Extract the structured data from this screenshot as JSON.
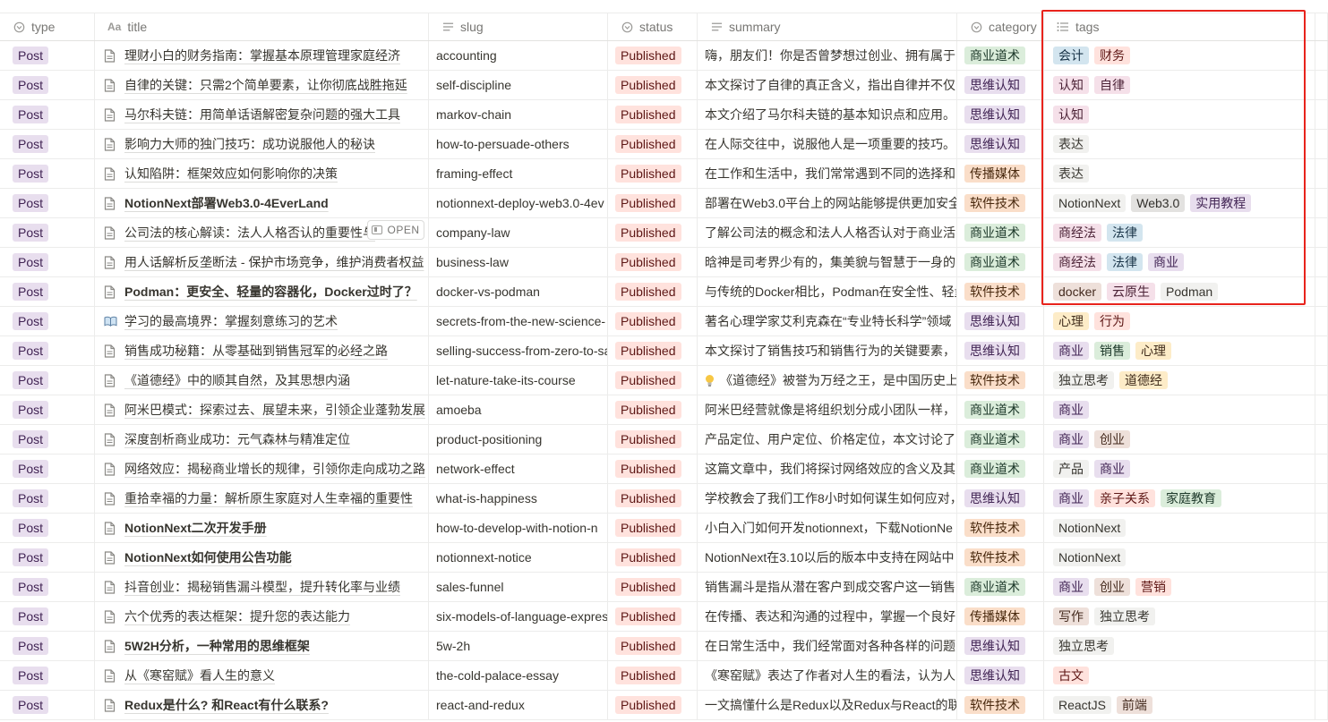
{
  "columns": [
    {
      "key": "type",
      "label": "type",
      "icon": "select-icon"
    },
    {
      "key": "title",
      "label": "title",
      "icon": "text-Aa-icon"
    },
    {
      "key": "slug",
      "label": "slug",
      "icon": "text-lines-icon"
    },
    {
      "key": "status",
      "label": "status",
      "icon": "select-icon"
    },
    {
      "key": "summary",
      "label": "summary",
      "icon": "text-lines-icon"
    },
    {
      "key": "category",
      "label": "category",
      "icon": "select-icon"
    },
    {
      "key": "tags",
      "label": "tags",
      "icon": "multi-select-list-icon"
    }
  ],
  "open_button_label": "OPEN",
  "colors": {
    "post_bg": "#e8deee",
    "post_fg": "#412454",
    "status_bg": "#ffe2dd",
    "status_fg": "#5d1715",
    "highlight_border": "#e8231c"
  },
  "tag_colors": {
    "green": {
      "bg": "#dbeddb",
      "fg": "#1c3829"
    },
    "purple": {
      "bg": "#e8deee",
      "fg": "#412454"
    },
    "orange": {
      "bg": "#fadec9",
      "fg": "#49290e"
    },
    "blue": {
      "bg": "#d3e5ef",
      "fg": "#183347"
    },
    "red": {
      "bg": "#ffe2dd",
      "fg": "#5d1715"
    },
    "pink": {
      "bg": "#f5e0e9",
      "fg": "#4c2337"
    },
    "brown": {
      "bg": "#eee0da",
      "fg": "#442a1e"
    },
    "yellow": {
      "bg": "#fdecc8",
      "fg": "#402c1b"
    },
    "gray": {
      "bg": "#e3e2e0",
      "fg": "#32302c"
    },
    "default": {
      "bg": "#f1f1ef",
      "fg": "#37352f"
    }
  },
  "rows": [
    {
      "type": "Post",
      "icon": "doc",
      "title": "理财小白的财务指南：掌握基本原理管理家庭经济",
      "bold": false,
      "slug": "accounting",
      "status": "Published",
      "summary": "嗨，朋友们！你是否曾梦想过创业、拥有属于",
      "category": {
        "name": "商业道术",
        "color": "green"
      },
      "tags": [
        {
          "name": "会计",
          "color": "blue"
        },
        {
          "name": "财务",
          "color": "red"
        }
      ]
    },
    {
      "type": "Post",
      "icon": "doc",
      "title": "自律的关键：只需2个简单要素，让你彻底战胜拖延",
      "bold": false,
      "slug": "self-discipline",
      "status": "Published",
      "summary": "本文探讨了自律的真正含义，指出自律并不仅",
      "category": {
        "name": "思维认知",
        "color": "purple"
      },
      "tags": [
        {
          "name": "认知",
          "color": "pink"
        },
        {
          "name": "自律",
          "color": "pink"
        }
      ]
    },
    {
      "type": "Post",
      "icon": "doc",
      "title": "马尔科夫链：用简单话语解密复杂问题的强大工具",
      "bold": false,
      "slug": "markov-chain",
      "status": "Published",
      "summary": "本文介绍了马尔科夫链的基本知识点和应用。",
      "category": {
        "name": "思维认知",
        "color": "purple"
      },
      "tags": [
        {
          "name": "认知",
          "color": "pink"
        }
      ]
    },
    {
      "type": "Post",
      "icon": "doc",
      "title": "影响力大师的独门技巧：成功说服他人的秘诀",
      "bold": false,
      "slug": "how-to-persuade-others",
      "status": "Published",
      "summary": "在人际交往中，说服他人是一项重要的技巧。",
      "category": {
        "name": "思维认知",
        "color": "purple"
      },
      "tags": [
        {
          "name": "表达",
          "color": "default"
        }
      ]
    },
    {
      "type": "Post",
      "icon": "doc",
      "title": "认知陷阱：框架效应如何影响你的决策",
      "bold": false,
      "slug": "framing-effect",
      "status": "Published",
      "summary": "在工作和生活中，我们常常遇到不同的选择和",
      "category": {
        "name": "传播媒体",
        "color": "orange"
      },
      "tags": [
        {
          "name": "表达",
          "color": "default"
        }
      ]
    },
    {
      "type": "Post",
      "icon": "doc",
      "title": "NotionNext部署Web3.0-4EverLand",
      "bold": true,
      "slug": "notionnext-deploy-web3.0-4ev",
      "status": "Published",
      "summary": "部署在Web3.0平台上的网站能够提供更加安全",
      "category": {
        "name": "软件技术",
        "color": "orange"
      },
      "tags": [
        {
          "name": "NotionNext",
          "color": "default"
        },
        {
          "name": "Web3.0",
          "color": "gray"
        },
        {
          "name": "实用教程",
          "color": "purple"
        }
      ]
    },
    {
      "type": "Post",
      "icon": "doc",
      "title": "公司法的核心解读：法人人格否认的重要性与",
      "bold": false,
      "slug": "company-law",
      "status": "Published",
      "summary": "了解公司法的概念和法人人格否认对于商业活",
      "category": {
        "name": "商业道术",
        "color": "green"
      },
      "tags": [
        {
          "name": "商经法",
          "color": "pink"
        },
        {
          "name": "法律",
          "color": "blue"
        }
      ]
    },
    {
      "type": "Post",
      "icon": "doc",
      "title": "用人话解析反垄断法 - 保护市场竞争，维护消费者权益",
      "bold": false,
      "slug": "business-law",
      "status": "Published",
      "summary": "晗神是司考界少有的，集美貌与智慧于一身的",
      "category": {
        "name": "商业道术",
        "color": "green"
      },
      "tags": [
        {
          "name": "商经法",
          "color": "pink"
        },
        {
          "name": "法律",
          "color": "blue"
        },
        {
          "name": "商业",
          "color": "purple"
        }
      ]
    },
    {
      "type": "Post",
      "icon": "doc",
      "title": "Podman：更安全、轻量的容器化，Docker过时了？",
      "bold": true,
      "slug": "docker-vs-podman",
      "status": "Published",
      "summary": "与传统的Docker相比，Podman在安全性、轻量",
      "category": {
        "name": "软件技术",
        "color": "orange"
      },
      "tags": [
        {
          "name": "docker",
          "color": "brown"
        },
        {
          "name": "云原生",
          "color": "pink"
        },
        {
          "name": "Podman",
          "color": "default"
        }
      ]
    },
    {
      "type": "Post",
      "icon": "book",
      "title": "学习的最高境界：掌握刻意练习的艺术",
      "bold": false,
      "slug": "secrets-from-the-new-science-",
      "status": "Published",
      "summary": "著名心理学家艾利克森在“专业特长科学”领域",
      "category": {
        "name": "思维认知",
        "color": "purple"
      },
      "tags": [
        {
          "name": "心理",
          "color": "yellow"
        },
        {
          "name": "行为",
          "color": "red"
        }
      ]
    },
    {
      "type": "Post",
      "icon": "doc",
      "title": "销售成功秘籍：从零基础到销售冠军的必经之路",
      "bold": false,
      "slug": "selling-success-from-zero-to-sa",
      "status": "Published",
      "summary": "本文探讨了销售技巧和销售行为的关键要素，",
      "category": {
        "name": "思维认知",
        "color": "purple"
      },
      "tags": [
        {
          "name": "商业",
          "color": "purple"
        },
        {
          "name": "销售",
          "color": "green"
        },
        {
          "name": "心理",
          "color": "yellow"
        }
      ]
    },
    {
      "type": "Post",
      "icon": "doc",
      "title": "《道德经》中的顺其自然，及其思想内涵",
      "bold": false,
      "slug": "let-nature-take-its-course",
      "status": "Published",
      "summary": "《道德经》被誉为万经之王，是中国历史上",
      "summary_icon": "bulb",
      "category": {
        "name": "软件技术",
        "color": "orange"
      },
      "tags": [
        {
          "name": "独立思考",
          "color": "default"
        },
        {
          "name": "道德经",
          "color": "yellow"
        }
      ]
    },
    {
      "type": "Post",
      "icon": "doc",
      "title": "阿米巴模式：探索过去、展望未来，引领企业蓬勃发展",
      "bold": false,
      "slug": "amoeba",
      "status": "Published",
      "summary": "阿米巴经营就像是将组织划分成小团队一样，",
      "category": {
        "name": "商业道术",
        "color": "green"
      },
      "tags": [
        {
          "name": "商业",
          "color": "purple"
        }
      ]
    },
    {
      "type": "Post",
      "icon": "doc",
      "title": "深度剖析商业成功：元气森林与精准定位",
      "bold": false,
      "slug": "product-positioning",
      "status": "Published",
      "summary": "产品定位、用户定位、价格定位，本文讨论了",
      "category": {
        "name": "商业道术",
        "color": "green"
      },
      "tags": [
        {
          "name": "商业",
          "color": "purple"
        },
        {
          "name": "创业",
          "color": "brown"
        }
      ]
    },
    {
      "type": "Post",
      "icon": "doc",
      "title": "网络效应：揭秘商业增长的规律，引领你走向成功之路",
      "bold": false,
      "slug": "network-effect",
      "status": "Published",
      "summary": "这篇文章中，我们将探讨网络效应的含义及其",
      "category": {
        "name": "商业道术",
        "color": "green"
      },
      "tags": [
        {
          "name": "产品",
          "color": "default"
        },
        {
          "name": "商业",
          "color": "purple"
        }
      ]
    },
    {
      "type": "Post",
      "icon": "doc",
      "title": "重拾幸福的力量：解析原生家庭对人生幸福的重要性",
      "bold": false,
      "slug": "what-is-happiness",
      "status": "Published",
      "summary": "学校教会了我们工作8小时如何谋生如何应对，",
      "category": {
        "name": "思维认知",
        "color": "purple"
      },
      "tags": [
        {
          "name": "商业",
          "color": "purple"
        },
        {
          "name": "亲子关系",
          "color": "red"
        },
        {
          "name": "家庭教育",
          "color": "green"
        }
      ]
    },
    {
      "type": "Post",
      "icon": "doc",
      "title": "NotionNext二次开发手册",
      "bold": true,
      "slug": "how-to-develop-with-notion-n",
      "status": "Published",
      "summary": "小白入门如何开发notionnext，下载NotionNe",
      "category": {
        "name": "软件技术",
        "color": "orange"
      },
      "tags": [
        {
          "name": "NotionNext",
          "color": "default"
        }
      ]
    },
    {
      "type": "Post",
      "icon": "doc",
      "title": "NotionNext如何使用公告功能",
      "bold": true,
      "slug": "notionnext-notice",
      "status": "Published",
      "summary": "NotionNext在3.10以后的版本中支持在网站中",
      "category": {
        "name": "软件技术",
        "color": "orange"
      },
      "tags": [
        {
          "name": "NotionNext",
          "color": "default"
        }
      ]
    },
    {
      "type": "Post",
      "icon": "doc",
      "title": "抖音创业：揭秘销售漏斗模型，提升转化率与业绩",
      "bold": false,
      "slug": "sales-funnel",
      "status": "Published",
      "summary": "销售漏斗是指从潜在客户到成交客户这一销售",
      "category": {
        "name": "商业道术",
        "color": "green"
      },
      "tags": [
        {
          "name": "商业",
          "color": "purple"
        },
        {
          "name": "创业",
          "color": "brown"
        },
        {
          "name": "营销",
          "color": "red"
        }
      ]
    },
    {
      "type": "Post",
      "icon": "doc",
      "title": "六个优秀的表达框架：提升您的表达能力",
      "bold": false,
      "slug": "six-models-of-language-expres",
      "status": "Published",
      "summary": "在传播、表达和沟通的过程中，掌握一个良好",
      "category": {
        "name": "传播媒体",
        "color": "orange"
      },
      "tags": [
        {
          "name": "写作",
          "color": "brown"
        },
        {
          "name": "独立思考",
          "color": "default"
        }
      ]
    },
    {
      "type": "Post",
      "icon": "doc",
      "title": "5W2H分析，一种常用的思维框架",
      "bold": true,
      "slug": "5w-2h",
      "status": "Published",
      "summary": "在日常生活中，我们经常面对各种各样的问题",
      "category": {
        "name": "思维认知",
        "color": "purple"
      },
      "tags": [
        {
          "name": "独立思考",
          "color": "default"
        }
      ]
    },
    {
      "type": "Post",
      "icon": "doc",
      "title": "从《寒窑赋》看人生的意义",
      "bold": false,
      "slug": "the-cold-palace-essay",
      "status": "Published",
      "summary": "《寒窑赋》表达了作者对人生的看法，认为人",
      "category": {
        "name": "思维认知",
        "color": "purple"
      },
      "tags": [
        {
          "name": "古文",
          "color": "red"
        }
      ]
    },
    {
      "type": "Post",
      "icon": "doc",
      "title": "Redux是什么? 和React有什么联系?",
      "bold": true,
      "slug": "react-and-redux",
      "status": "Published",
      "summary": "一文搞懂什么是Redux以及Redux与React的联系",
      "category": {
        "name": "软件技术",
        "color": "orange"
      },
      "tags": [
        {
          "name": "ReactJS",
          "color": "default"
        },
        {
          "name": "前端",
          "color": "brown"
        }
      ]
    }
  ]
}
